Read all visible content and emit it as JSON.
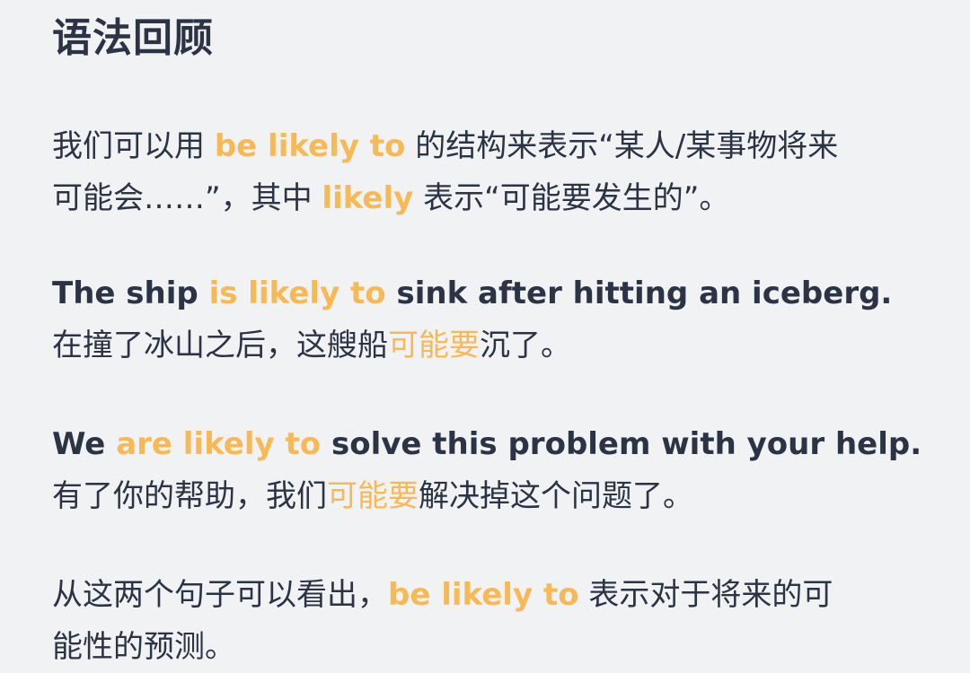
{
  "title": "语法回顾",
  "intro": {
    "line1_before": "我们可以用 ",
    "line1_highlight": "be likely to",
    "line1_after": " 的结构来表示“某人/某事物将来",
    "line2_before": "可能会……”，其中 ",
    "line2_highlight": "likely",
    "line2_after": " 表示“可能要发生的”。"
  },
  "examples": [
    {
      "en_before": "The ship ",
      "en_highlight": "is likely to",
      "en_after": " sink after hitting an iceberg.",
      "cn_before": "在撞了冰山之后，这艘船",
      "cn_highlight": "可能要",
      "cn_after": "沉了。"
    },
    {
      "en_before": "We ",
      "en_highlight": "are likely to",
      "en_after": " solve this problem with your help.",
      "cn_before": "有了你的帮助，我们",
      "cn_highlight": "可能要",
      "cn_after": "解决掉这个问题了。"
    }
  ],
  "conclusion": {
    "line1_before": "从这两个句子可以看出，",
    "line1_highlight": "be likely to",
    "line1_after": " 表示对于将来的可",
    "line2": "能性的预测。"
  },
  "colors": {
    "background": "#f1f2f4",
    "text": "#2b3344",
    "highlight": "#f7b955"
  }
}
